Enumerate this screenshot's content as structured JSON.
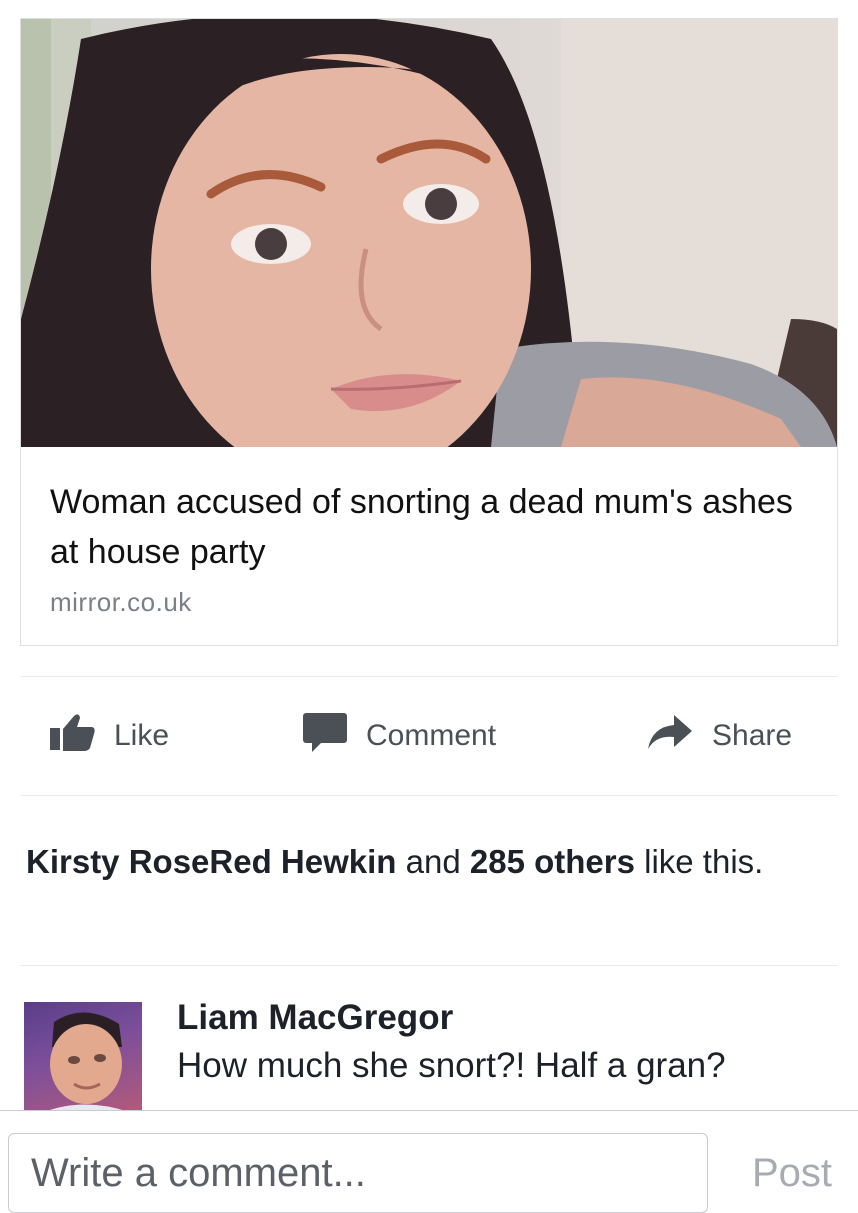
{
  "post": {
    "headline": "Woman accused of snorting a dead mum's ashes at house party",
    "domain": "mirror.co.uk"
  },
  "actions": {
    "like": "Like",
    "comment": "Comment",
    "share": "Share"
  },
  "likes": {
    "first_name": "Kirsty RoseRed Hewkin",
    "connector": " and ",
    "others": "285 others",
    "suffix": " like this."
  },
  "comment": {
    "author": "Liam MacGregor",
    "text": "How much she snort?! Half a gran?"
  },
  "composer": {
    "placeholder": "Write a comment...",
    "post_label": "Post"
  },
  "colors": {
    "action_gray": "#4b4f56",
    "divider": "#e9ebee",
    "muted": "#7b7f86"
  }
}
